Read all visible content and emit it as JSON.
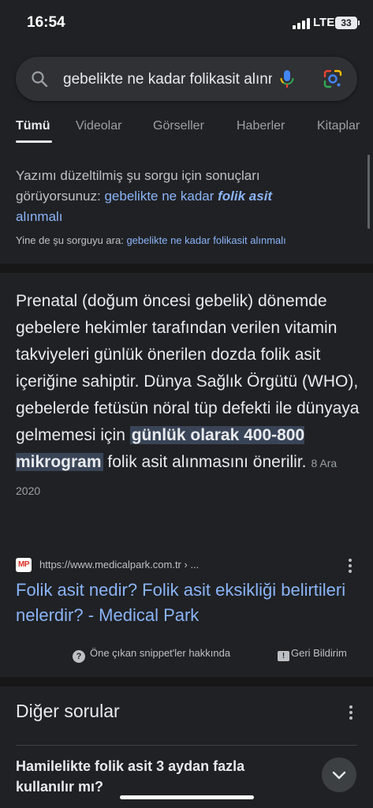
{
  "status_bar": {
    "time": "16:54",
    "network": "LTE",
    "battery": "33"
  },
  "search": {
    "query": "gebelikte ne kadar folikasit alınmalı"
  },
  "tabs": [
    {
      "label": "Tümü",
      "active": true
    },
    {
      "label": "Videolar"
    },
    {
      "label": "Görseller"
    },
    {
      "label": "Haberler"
    },
    {
      "label": "Kitaplar"
    }
  ],
  "spell": {
    "prefix_1": "Yazımı düzeltilmiş şu sorgu için sonuçları",
    "prefix_2": "görüyorsunuz: ",
    "corrected_plain": "gebelikte ne kadar ",
    "corrected_bold": "folik asit",
    "corrected_end": "alınmalı",
    "instead_prefix": "Yine de şu sorguyu ara: ",
    "instead_query": "gebelikte ne kadar folikasit alınmalı"
  },
  "snippet": {
    "text_before": "Prenatal (doğum öncesi gebelik) dönemde gebelere hekimler tarafından verilen vitamin takviyeleri günlük önerilen dozda folik asit içeriğine sahiptir. Dünya Sağlık Örgütü (WHO), gebelerde fetüsün nöral tüp defekti ile dünyaya gelmemesi için ",
    "highlight": "günlük olarak 400-800 mikrogram",
    "text_after": " folik asit alınmasını önerilir.",
    "date": "8 Ara 2020"
  },
  "source": {
    "favicon_text": "MP",
    "url": "https://www.medicalpark.com.tr › ...",
    "title": "Folik asit nedir? Folik asit eksikliği belirtileri nelerdir? - Medical Park"
  },
  "footer": {
    "about": "Öne çıkan snippet'ler hakkında",
    "feedback": "Geri Bildirim"
  },
  "other_questions": {
    "title": "Diğer sorular",
    "items": [
      {
        "question": "Hamilelikte folik asit 3 aydan fazla kullanılır mı?"
      }
    ]
  },
  "colors": {
    "background": "#202124",
    "link": "#8ab4f8",
    "text": "#e8eaed",
    "highlight": "#394457"
  },
  "icons": [
    "search-icon",
    "mic-icon",
    "lens-icon",
    "more-vert-icon",
    "help-icon",
    "feedback-icon",
    "chevron-down-icon"
  ]
}
